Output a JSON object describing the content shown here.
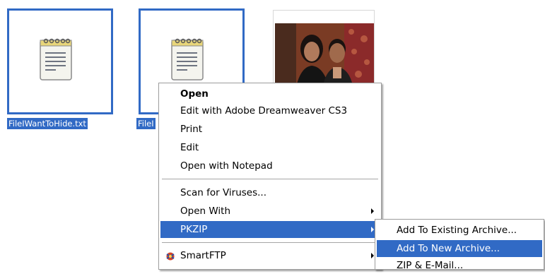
{
  "files": [
    {
      "name": "FileIWantToHide.txt",
      "icon": "notepad-icon",
      "selected": true
    },
    {
      "name": "FileI",
      "icon": "notepad-icon",
      "selected": true
    },
    {
      "name": "",
      "icon": "photo-thumbnail",
      "selected": false
    }
  ],
  "context_menu": {
    "items": [
      {
        "label": "Open",
        "bold": true
      },
      {
        "label": "Edit with Adobe Dreamweaver CS3"
      },
      {
        "label": "Print"
      },
      {
        "label": "Edit"
      },
      {
        "label": "Open with Notepad"
      },
      {
        "label": "Scan for Viruses..."
      },
      {
        "label": "Open With",
        "submenu": true
      },
      {
        "label": "PKZIP",
        "submenu": true,
        "highlighted": true
      },
      {
        "label": "SmartFTP",
        "submenu": true,
        "icon": "smartftp-icon"
      }
    ]
  },
  "pkzip_submenu": {
    "items": [
      {
        "label": "Add To Existing Archive..."
      },
      {
        "label": "Add To New Archive...",
        "highlighted": true
      },
      {
        "label": "ZIP & E-Mail..."
      }
    ]
  },
  "colors": {
    "selection": "#316ac5",
    "menu_border": "#9d9d9d"
  }
}
